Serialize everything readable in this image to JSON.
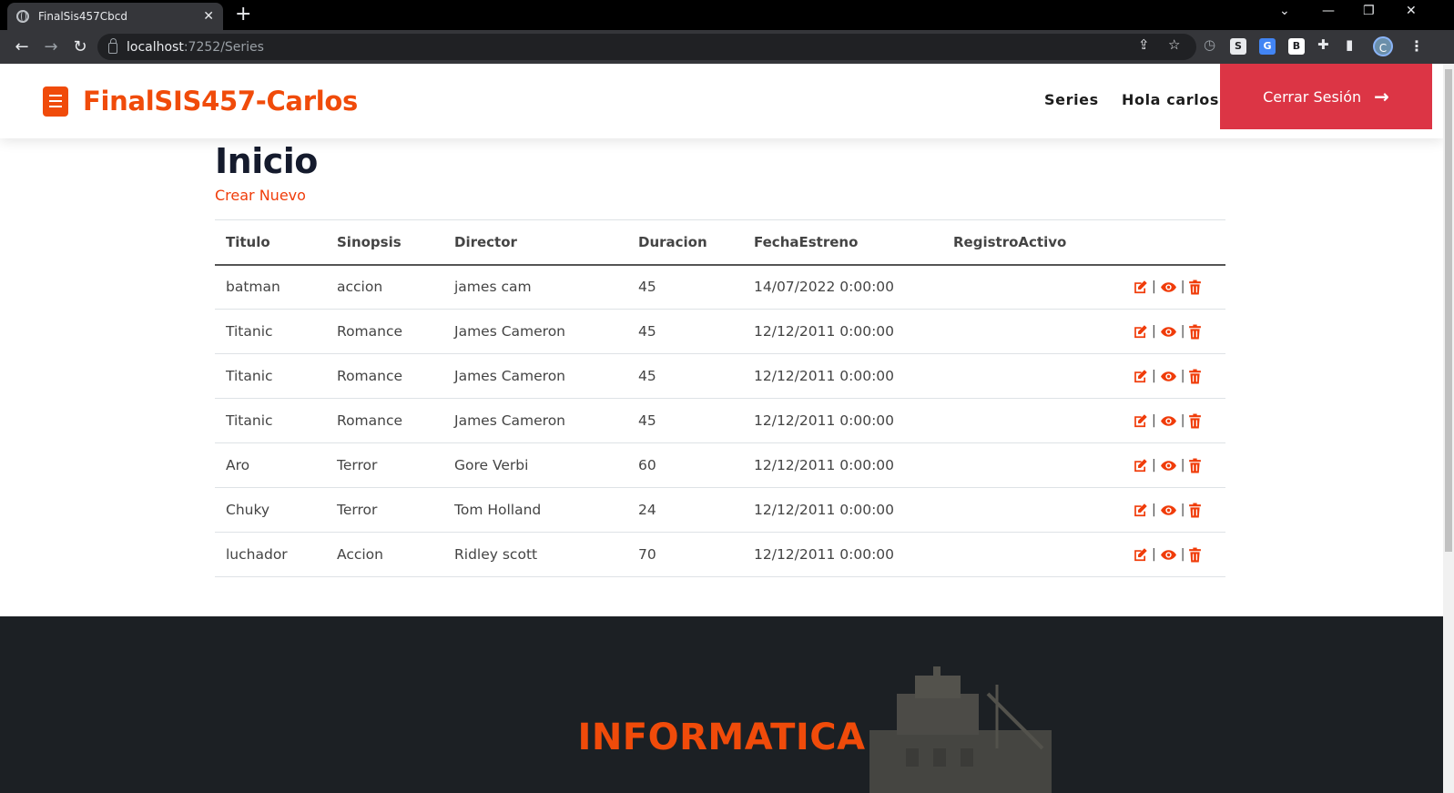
{
  "browser": {
    "tab_title": "FinalSis457Cbcd",
    "url_host": "localhost",
    "url_path": ":7252/Series",
    "profile_initial": "C"
  },
  "header": {
    "brand": "FinalSIS457-Carlos",
    "nav": {
      "series": "Series",
      "greeting": "Hola carlos"
    },
    "logout_label": "Cerrar Sesión"
  },
  "main": {
    "title": "Inicio",
    "create_link": "Crear Nuevo",
    "columns": [
      "Titulo",
      "Sinopsis",
      "Director",
      "Duracion",
      "FechaEstreno",
      "RegistroActivo"
    ],
    "rows": [
      {
        "titulo": "batman",
        "sinopsis": "accion",
        "director": "james cam",
        "duracion": "45",
        "fecha": "14/07/2022 0:00:00",
        "activo": ""
      },
      {
        "titulo": "Titanic",
        "sinopsis": "Romance",
        "director": "James Cameron",
        "duracion": "45",
        "fecha": "12/12/2011 0:00:00",
        "activo": ""
      },
      {
        "titulo": "Titanic",
        "sinopsis": "Romance",
        "director": "James Cameron",
        "duracion": "45",
        "fecha": "12/12/2011 0:00:00",
        "activo": ""
      },
      {
        "titulo": "Titanic",
        "sinopsis": "Romance",
        "director": "James Cameron",
        "duracion": "45",
        "fecha": "12/12/2011 0:00:00",
        "activo": ""
      },
      {
        "titulo": "Aro",
        "sinopsis": "Terror",
        "director": "Gore Verbi",
        "duracion": "60",
        "fecha": "12/12/2011 0:00:00",
        "activo": ""
      },
      {
        "titulo": "Chuky",
        "sinopsis": "Terror",
        "director": "Tom Holland",
        "duracion": "24",
        "fecha": "12/12/2011 0:00:00",
        "activo": ""
      },
      {
        "titulo": "luchador",
        "sinopsis": "Accion",
        "director": "Ridley scott",
        "duracion": "70",
        "fecha": "12/12/2011 0:00:00",
        "activo": ""
      }
    ],
    "separator": "|"
  },
  "footer": {
    "title": "INFORMATICA"
  },
  "colors": {
    "brand": "#f04b0a",
    "logout": "#dc3545",
    "footer_bg": "#1c2024"
  }
}
